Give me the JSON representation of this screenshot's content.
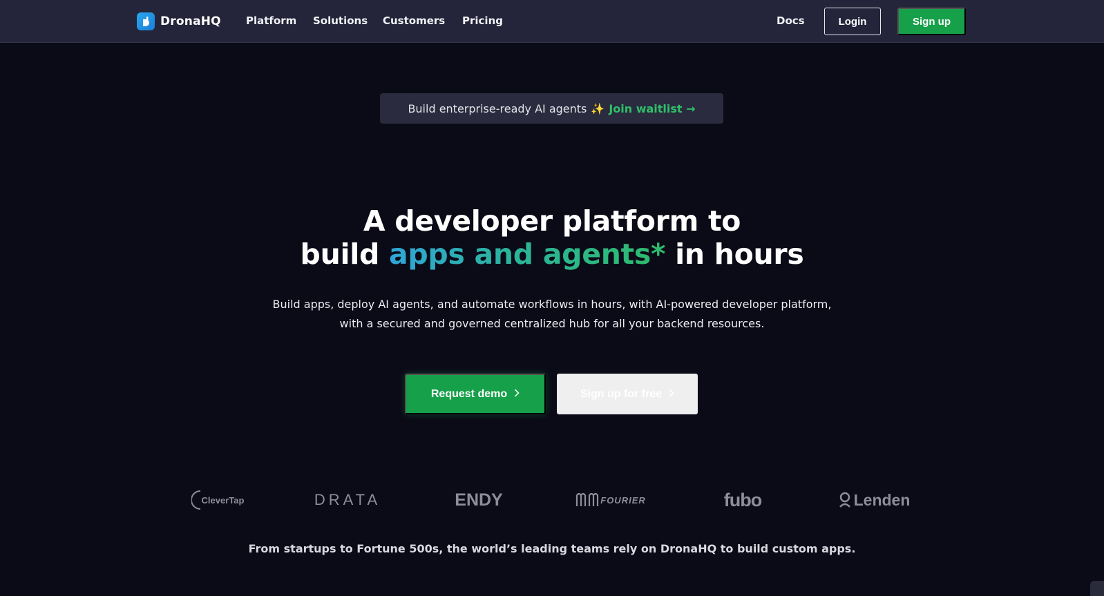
{
  "nav": {
    "brand": "DronaHQ",
    "links": [
      "Platform",
      "Solutions",
      "Customers",
      "Pricing"
    ],
    "docs": "Docs",
    "login": "Login",
    "signup": "Sign up"
  },
  "banner": {
    "text": "Build enterprise-ready AI agents",
    "sparkle": "✨",
    "cta": "Join waitlist",
    "cta_arrow": "→"
  },
  "hero": {
    "line1": "A developer platform to",
    "line2_prefix": "build",
    "line2_highlight": "apps and agents*",
    "line2_suffix": "in hours",
    "subtitle_line1": "Build apps, deploy AI agents, and automate workflows in hours, with AI-powered developer platform,",
    "subtitle_line2": "with a secured and governed centralized hub for all your backend resources."
  },
  "buttons": {
    "request_demo": "Request demo",
    "signup_free": "Sign up for free"
  },
  "customers": {
    "logos": [
      "CleverTap",
      "DRATA",
      "ENDY",
      "FOURIER",
      "fubo",
      "Lenden"
    ]
  },
  "footer": {
    "text": "From startups to Fortune 500s, the world’s leading teams rely on DronaHQ to build custom apps."
  },
  "colors": {
    "background": "#0b0b17",
    "nav_background": "#24253a",
    "accent_green": "#17a04a",
    "gradient_blue": "#2fa6d9",
    "gradient_green": "#2dbb6b"
  }
}
